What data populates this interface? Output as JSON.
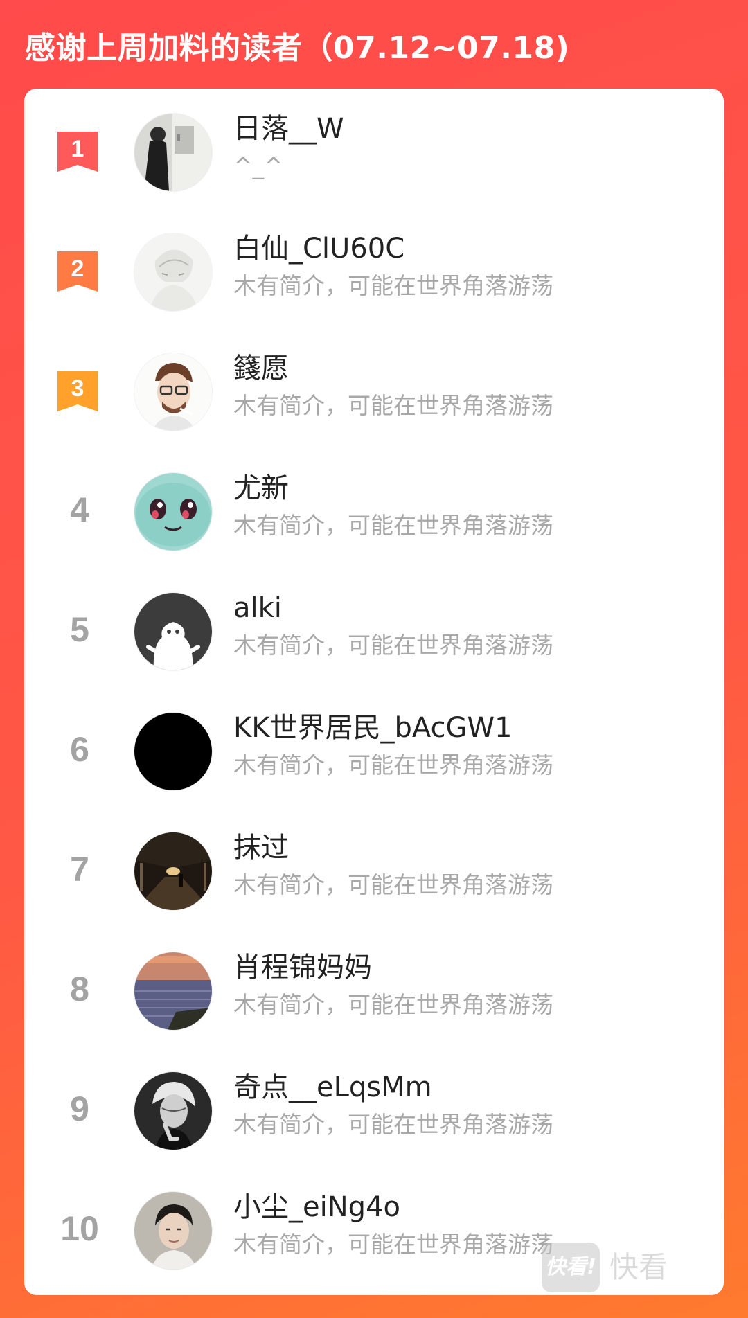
{
  "header": {
    "title": "感谢上周加料的读者（07.12~07.18)"
  },
  "accent_colors": {
    "rank1": "#ff5a5a",
    "rank2": "#ff7b43",
    "rank3": "#ffa12a",
    "background_top": "#ff4b4b",
    "background_bottom": "#ff7a2e"
  },
  "readers": [
    {
      "rank": "1",
      "name": "日落__W",
      "bio": "^_^",
      "avatar": "avatar-photo-dark-figure"
    },
    {
      "rank": "2",
      "name": "白仙_ClU60C",
      "bio": "木有简介，可能在世界角落游荡",
      "avatar": "avatar-sketch-portrait"
    },
    {
      "rank": "3",
      "name": "籛愿",
      "bio": "木有简介，可能在世界角落游荡",
      "avatar": "avatar-cartoon-man-glasses"
    },
    {
      "rank": "4",
      "name": "尤新",
      "bio": "木有简介，可能在世界角落游荡",
      "avatar": "avatar-cartoon-turtle"
    },
    {
      "rank": "5",
      "name": "alki",
      "bio": "木有简介，可能在世界角落游荡",
      "avatar": "avatar-default-ghost"
    },
    {
      "rank": "6",
      "name": "KK世界居民_bAcGW1",
      "bio": "木有简介，可能在世界角落游荡",
      "avatar": "avatar-solid-black"
    },
    {
      "rank": "7",
      "name": "抹过",
      "bio": "木有简介，可能在世界角落游荡",
      "avatar": "avatar-night-corridor"
    },
    {
      "rank": "8",
      "name": "肖程锦妈妈",
      "bio": "木有简介，可能在世界角落游荡",
      "avatar": "avatar-lake-sunset"
    },
    {
      "rank": "9",
      "name": "奇点__eLqsMm",
      "bio": "木有简介，可能在世界角落游荡",
      "avatar": "avatar-white-hair-figure"
    },
    {
      "rank": "10",
      "name": "小尘_eiNg4o",
      "bio": "木有简介，可能在世界角落游荡",
      "avatar": "avatar-young-man-photo"
    }
  ],
  "watermark": {
    "logo_text": "快看!",
    "text": "快看"
  }
}
